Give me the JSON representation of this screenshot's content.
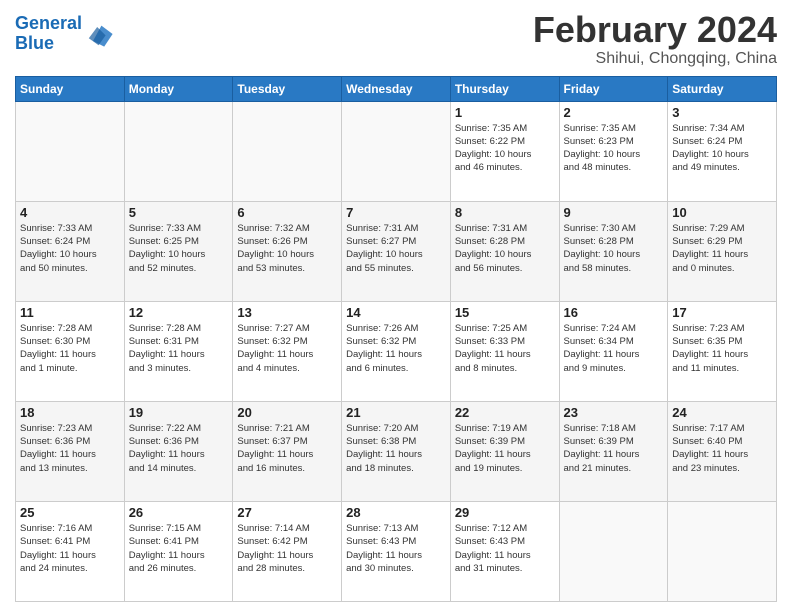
{
  "header": {
    "logo_line1": "General",
    "logo_line2": "Blue",
    "month_title": "February 2024",
    "subtitle": "Shihui, Chongqing, China"
  },
  "weekdays": [
    "Sunday",
    "Monday",
    "Tuesday",
    "Wednesday",
    "Thursday",
    "Friday",
    "Saturday"
  ],
  "weeks": [
    [
      {
        "day": "",
        "info": ""
      },
      {
        "day": "",
        "info": ""
      },
      {
        "day": "",
        "info": ""
      },
      {
        "day": "",
        "info": ""
      },
      {
        "day": "1",
        "info": "Sunrise: 7:35 AM\nSunset: 6:22 PM\nDaylight: 10 hours\nand 46 minutes."
      },
      {
        "day": "2",
        "info": "Sunrise: 7:35 AM\nSunset: 6:23 PM\nDaylight: 10 hours\nand 48 minutes."
      },
      {
        "day": "3",
        "info": "Sunrise: 7:34 AM\nSunset: 6:24 PM\nDaylight: 10 hours\nand 49 minutes."
      }
    ],
    [
      {
        "day": "4",
        "info": "Sunrise: 7:33 AM\nSunset: 6:24 PM\nDaylight: 10 hours\nand 50 minutes."
      },
      {
        "day": "5",
        "info": "Sunrise: 7:33 AM\nSunset: 6:25 PM\nDaylight: 10 hours\nand 52 minutes."
      },
      {
        "day": "6",
        "info": "Sunrise: 7:32 AM\nSunset: 6:26 PM\nDaylight: 10 hours\nand 53 minutes."
      },
      {
        "day": "7",
        "info": "Sunrise: 7:31 AM\nSunset: 6:27 PM\nDaylight: 10 hours\nand 55 minutes."
      },
      {
        "day": "8",
        "info": "Sunrise: 7:31 AM\nSunset: 6:28 PM\nDaylight: 10 hours\nand 56 minutes."
      },
      {
        "day": "9",
        "info": "Sunrise: 7:30 AM\nSunset: 6:28 PM\nDaylight: 10 hours\nand 58 minutes."
      },
      {
        "day": "10",
        "info": "Sunrise: 7:29 AM\nSunset: 6:29 PM\nDaylight: 11 hours\nand 0 minutes."
      }
    ],
    [
      {
        "day": "11",
        "info": "Sunrise: 7:28 AM\nSunset: 6:30 PM\nDaylight: 11 hours\nand 1 minute."
      },
      {
        "day": "12",
        "info": "Sunrise: 7:28 AM\nSunset: 6:31 PM\nDaylight: 11 hours\nand 3 minutes."
      },
      {
        "day": "13",
        "info": "Sunrise: 7:27 AM\nSunset: 6:32 PM\nDaylight: 11 hours\nand 4 minutes."
      },
      {
        "day": "14",
        "info": "Sunrise: 7:26 AM\nSunset: 6:32 PM\nDaylight: 11 hours\nand 6 minutes."
      },
      {
        "day": "15",
        "info": "Sunrise: 7:25 AM\nSunset: 6:33 PM\nDaylight: 11 hours\nand 8 minutes."
      },
      {
        "day": "16",
        "info": "Sunrise: 7:24 AM\nSunset: 6:34 PM\nDaylight: 11 hours\nand 9 minutes."
      },
      {
        "day": "17",
        "info": "Sunrise: 7:23 AM\nSunset: 6:35 PM\nDaylight: 11 hours\nand 11 minutes."
      }
    ],
    [
      {
        "day": "18",
        "info": "Sunrise: 7:23 AM\nSunset: 6:36 PM\nDaylight: 11 hours\nand 13 minutes."
      },
      {
        "day": "19",
        "info": "Sunrise: 7:22 AM\nSunset: 6:36 PM\nDaylight: 11 hours\nand 14 minutes."
      },
      {
        "day": "20",
        "info": "Sunrise: 7:21 AM\nSunset: 6:37 PM\nDaylight: 11 hours\nand 16 minutes."
      },
      {
        "day": "21",
        "info": "Sunrise: 7:20 AM\nSunset: 6:38 PM\nDaylight: 11 hours\nand 18 minutes."
      },
      {
        "day": "22",
        "info": "Sunrise: 7:19 AM\nSunset: 6:39 PM\nDaylight: 11 hours\nand 19 minutes."
      },
      {
        "day": "23",
        "info": "Sunrise: 7:18 AM\nSunset: 6:39 PM\nDaylight: 11 hours\nand 21 minutes."
      },
      {
        "day": "24",
        "info": "Sunrise: 7:17 AM\nSunset: 6:40 PM\nDaylight: 11 hours\nand 23 minutes."
      }
    ],
    [
      {
        "day": "25",
        "info": "Sunrise: 7:16 AM\nSunset: 6:41 PM\nDaylight: 11 hours\nand 24 minutes."
      },
      {
        "day": "26",
        "info": "Sunrise: 7:15 AM\nSunset: 6:41 PM\nDaylight: 11 hours\nand 26 minutes."
      },
      {
        "day": "27",
        "info": "Sunrise: 7:14 AM\nSunset: 6:42 PM\nDaylight: 11 hours\nand 28 minutes."
      },
      {
        "day": "28",
        "info": "Sunrise: 7:13 AM\nSunset: 6:43 PM\nDaylight: 11 hours\nand 30 minutes."
      },
      {
        "day": "29",
        "info": "Sunrise: 7:12 AM\nSunset: 6:43 PM\nDaylight: 11 hours\nand 31 minutes."
      },
      {
        "day": "",
        "info": ""
      },
      {
        "day": "",
        "info": ""
      }
    ]
  ]
}
